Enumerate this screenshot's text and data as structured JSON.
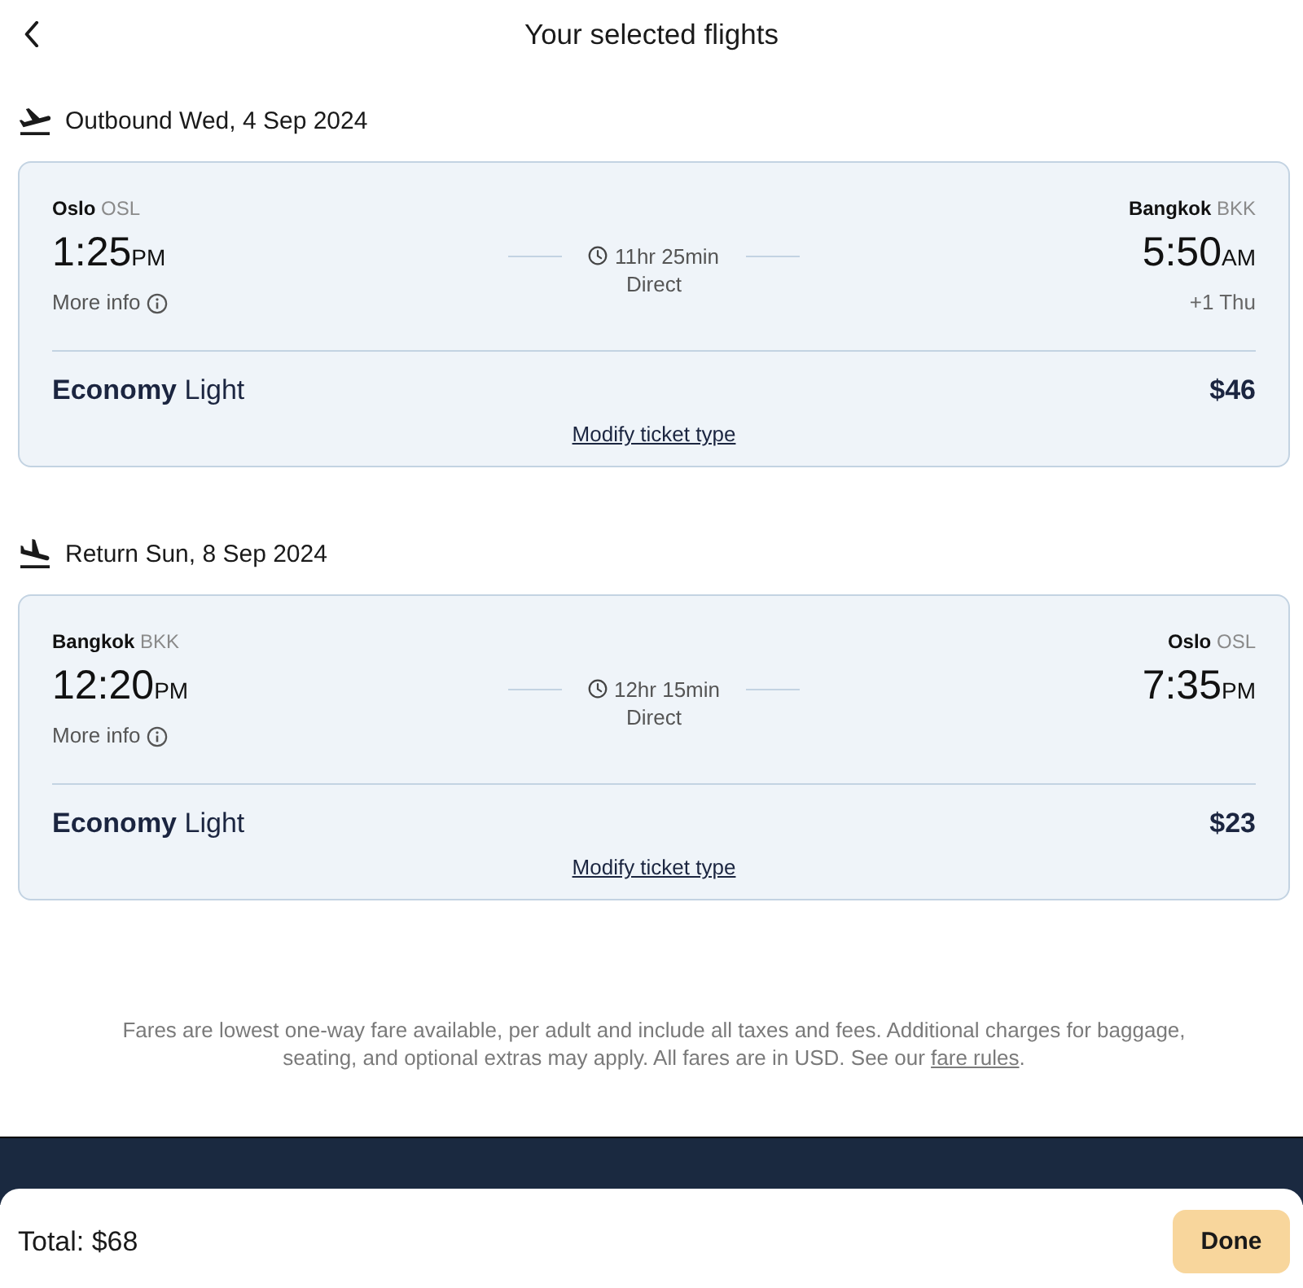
{
  "header": {
    "title": "Your selected flights"
  },
  "segments": [
    {
      "kind": "outbound",
      "heading": "Outbound Wed, 4 Sep 2024",
      "departure": {
        "city": "Oslo",
        "code": "OSL",
        "time": "1:25",
        "period": "PM"
      },
      "more_info": "More info",
      "duration": "11hr 25min",
      "stops": "Direct",
      "arrival": {
        "city": "Bangkok",
        "code": "BKK",
        "time": "5:50",
        "period": "AM",
        "day_offset": "+1 Thu"
      },
      "fare": {
        "cabin": "Economy",
        "brand": "Light",
        "price": "$46"
      },
      "modify_link": "Modify ticket type"
    },
    {
      "kind": "return",
      "heading": "Return Sun, 8 Sep 2024",
      "departure": {
        "city": "Bangkok",
        "code": "BKK",
        "time": "12:20",
        "period": "PM"
      },
      "more_info": "More info",
      "duration": "12hr 15min",
      "stops": "Direct",
      "arrival": {
        "city": "Oslo",
        "code": "OSL",
        "time": "7:35",
        "period": "PM"
      },
      "fare": {
        "cabin": "Economy",
        "brand": "Light",
        "price": "$23"
      },
      "modify_link": "Modify ticket type"
    }
  ],
  "disclaimer": {
    "text": "Fares are lowest one-way fare available, per adult and include all taxes and fees. Additional charges for baggage, seating, and optional extras may apply. All fares are in USD. See our ",
    "link": "fare rules",
    "end": "."
  },
  "footer": {
    "total": "Total: $68",
    "done_button": "Done"
  }
}
